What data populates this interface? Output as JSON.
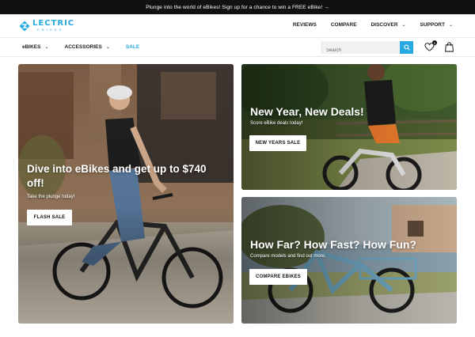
{
  "announcement": {
    "text": "Plunge into the world of eBikes! Sign up for a chance to win a FREE eBike! →"
  },
  "logo": {
    "word": "LECTRIC",
    "sub": "EBIKES",
    "color": "#27a9e1"
  },
  "top_nav": {
    "items": [
      {
        "label": "REVIEWS",
        "chevron": false
      },
      {
        "label": "COMPARE",
        "chevron": false
      },
      {
        "label": "DISCOVER",
        "chevron": true
      },
      {
        "label": "SUPPORT",
        "chevron": true
      }
    ]
  },
  "category_nav": {
    "items": [
      {
        "label": "eBIKES",
        "chevron": true
      },
      {
        "label": "ACCESSORIES",
        "chevron": true
      },
      {
        "label": "SALE",
        "chevron": false
      }
    ]
  },
  "search": {
    "placeholder": "Search",
    "icon": "search-icon"
  },
  "header_icons": {
    "wishlist_icon": "heart-icon",
    "wishlist_count": "0",
    "cart_icon": "shopping-bag-icon"
  },
  "chevron_glyph": "⌄",
  "hero": {
    "title": "Dive into eBikes and get up to $740 off!",
    "subtitle": "Take the plunge today!",
    "button": "FLASH SALE"
  },
  "promo_top": {
    "title": "New Year, New Deals!",
    "subtitle": "Score eBike deals today!",
    "button": "NEW YEARS SALE"
  },
  "promo_bottom": {
    "title": "How Far? How Fast? How Fun?",
    "subtitle": "Compare models and find out more.",
    "button": "COMPARE EBIKES"
  },
  "colors": {
    "accent": "#27a9e1",
    "announcement_bg": "#111111"
  }
}
